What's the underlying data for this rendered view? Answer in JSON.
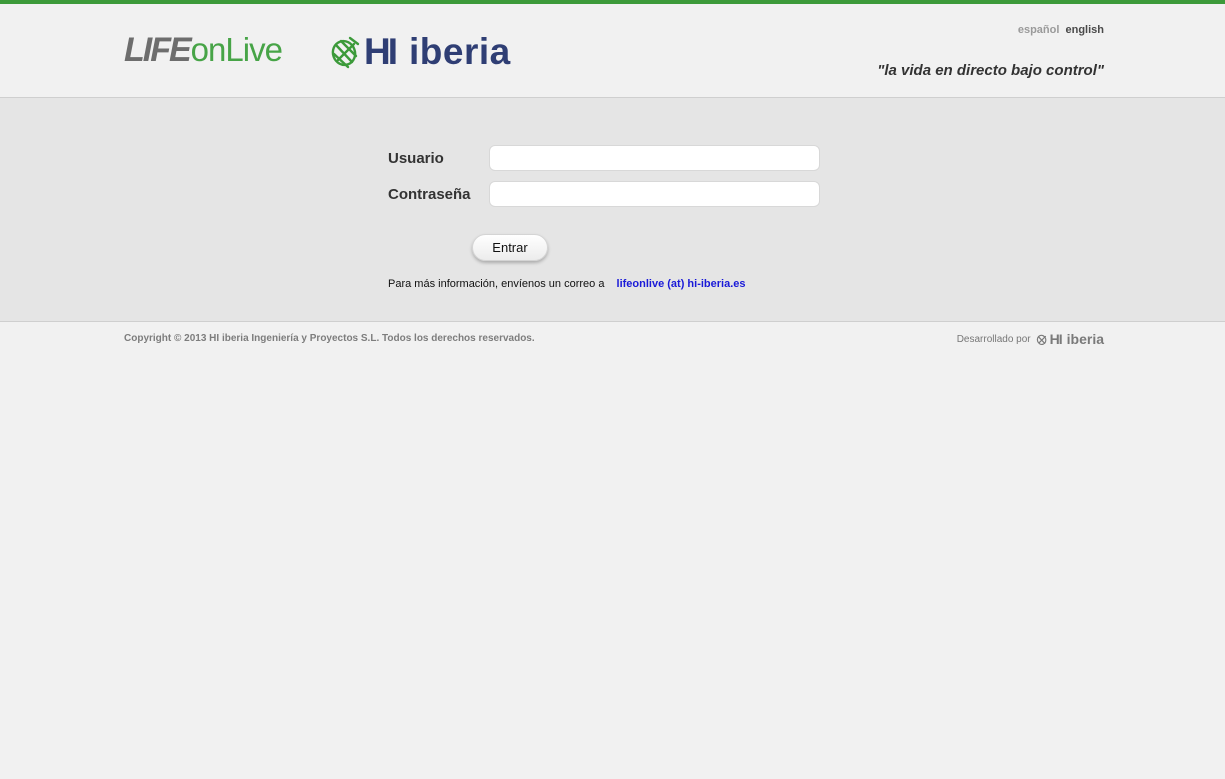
{
  "header": {
    "logo_life": "LIFE",
    "logo_onlive": "onLive",
    "logo_hi": "HI",
    "logo_iberia": "iberia",
    "lang_es": "español",
    "lang_en": "english",
    "tagline": "\"la vida en directo bajo control\""
  },
  "login": {
    "user_label": "Usuario",
    "user_value": "",
    "password_label": "Contraseña",
    "password_value": "",
    "submit_label": "Entrar",
    "info_text": "Para más información, envíenos un correo a",
    "info_email": "lifeonlive (at) hi-iberia.es"
  },
  "footer": {
    "copyright": "Copyright © 2013 HI iberia Ingeniería y Proyectos S.L. Todos los derechos reservados.",
    "developed_by": "Desarrollado por",
    "dev_logo_hi": "HI",
    "dev_logo_iberia": "iberia"
  },
  "colors": {
    "accent_green": "#3c9a3a",
    "brand_blue": "#2f3e74",
    "link_blue": "#1a1ad8"
  },
  "icons": {
    "brand_globe": "globe-icon"
  }
}
